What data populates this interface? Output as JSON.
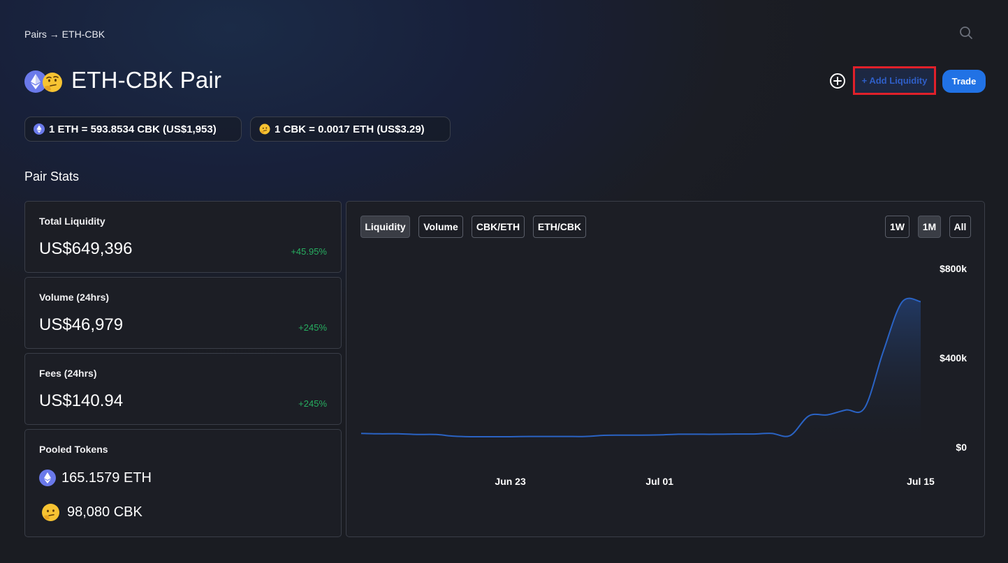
{
  "breadcrumb": "Pairs → ETH-CBK",
  "title": "ETH-CBK Pair",
  "actions": {
    "add_liquidity": "+ Add Liquidity",
    "trade": "Trade"
  },
  "rates": {
    "eth": "1 ETH = 593.8534 CBK (US$1,953)",
    "cbk": "1 CBK = 0.0017 ETH (US$3.29)"
  },
  "section_title": "Pair Stats",
  "stats": [
    {
      "label": "Total Liquidity",
      "value": "US$649,396",
      "change": "+45.95%"
    },
    {
      "label": "Volume (24hrs)",
      "value": "US$46,979",
      "change": "+245%"
    },
    {
      "label": "Fees (24hrs)",
      "value": "US$140.94",
      "change": "+245%"
    }
  ],
  "pooled": {
    "label": "Pooled Tokens",
    "eth": "165.1579 ETH",
    "cbk": "98,080 CBK"
  },
  "chart_tabs": [
    "Liquidity",
    "Volume",
    "CBK/ETH",
    "ETH/CBK"
  ],
  "active_tab": "Liquidity",
  "time_ranges": [
    "1W",
    "1M",
    "All"
  ],
  "active_range": "1M",
  "colors": {
    "accent": "#2172e5",
    "positive": "#27ae60",
    "line": "#2a63c4",
    "highlight": "#e0202a"
  },
  "chart_data": {
    "type": "area",
    "series": [
      {
        "x": [
          "Jun 15",
          "Jun 16",
          "Jun 17",
          "Jun 18",
          "Jun 19",
          "Jun 20",
          "Jun 21",
          "Jun 22",
          "Jun 23",
          "Jun 24",
          "Jun 25",
          "Jun 26",
          "Jun 27",
          "Jun 28",
          "Jun 29",
          "Jun 30",
          "Jul 01",
          "Jul 02",
          "Jul 03",
          "Jul 04",
          "Jul 05",
          "Jul 06",
          "Jul 07",
          "Jul 08",
          "Jul 09",
          "Jul 10",
          "Jul 11",
          "Jul 12",
          "Jul 13",
          "Jul 14",
          "Jul 15"
        ],
        "values": [
          62000,
          60000,
          60000,
          57000,
          57000,
          49000,
          47000,
          47000,
          47000,
          48000,
          48000,
          48000,
          48000,
          53000,
          54000,
          54000,
          55000,
          58000,
          58000,
          58000,
          59000,
          59000,
          62000,
          52000,
          140000,
          145000,
          167000,
          177000,
          430000,
          650000,
          652000
        ]
      }
    ],
    "x_ticks": [
      "Jun 23",
      "Jul 01",
      "Jul 15"
    ],
    "y_ticks": [
      {
        "value": 800000,
        "label": "$800k"
      },
      {
        "value": 400000,
        "label": "$400k"
      },
      {
        "value": 0,
        "label": "$0"
      }
    ],
    "ylim": [
      0,
      800000
    ],
    "grid": false,
    "legend": "none"
  }
}
